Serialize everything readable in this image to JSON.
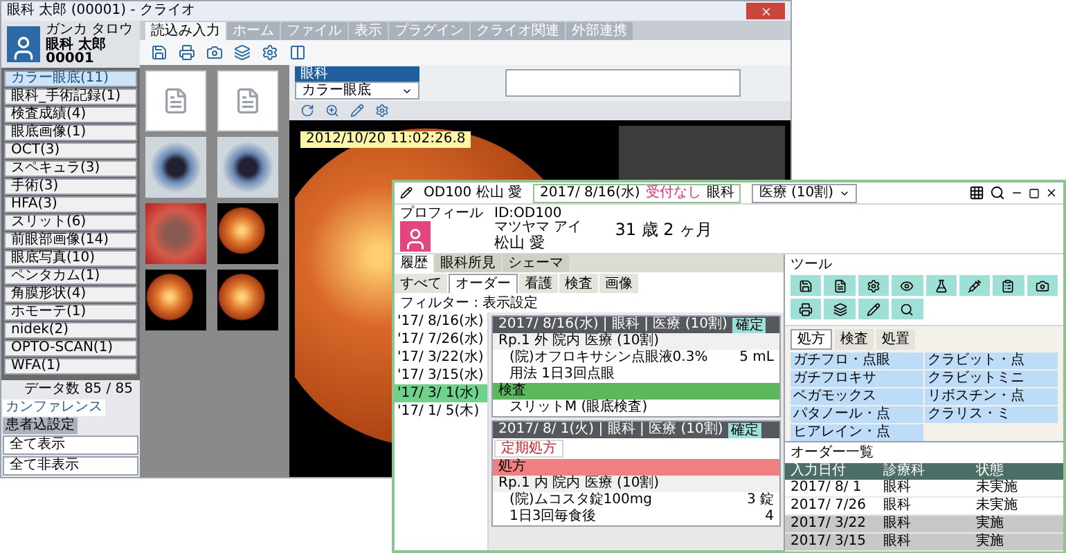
{
  "viewer_window": {
    "title": "眼科 太郎 (00001) - クライオ",
    "patient": {
      "kana": "ガンカ タロウ",
      "name": "眼科 太郎",
      "id": "00001"
    },
    "ribbon_tabs": [
      {
        "label": "読込み入力",
        "selected": true
      },
      {
        "label": "ホーム",
        "selected": false
      },
      {
        "label": "ファイル",
        "selected": false
      },
      {
        "label": "表示",
        "selected": false
      },
      {
        "label": "プラグイン",
        "selected": false
      },
      {
        "label": "クライオ関連",
        "selected": false
      },
      {
        "label": "外部連携",
        "selected": false
      }
    ],
    "categories": [
      {
        "label": "カラー眼底(11)",
        "selected": true
      },
      {
        "label": "眼科_手術記録(1)",
        "selected": false
      },
      {
        "label": "検査成績(4)",
        "selected": false
      },
      {
        "label": "眼底画像(1)",
        "selected": false
      },
      {
        "label": "OCT(3)",
        "selected": false
      },
      {
        "label": "スペキュラ(3)",
        "selected": false
      },
      {
        "label": "手術(3)",
        "selected": false
      },
      {
        "label": "HFA(3)",
        "selected": false
      },
      {
        "label": "スリット(6)",
        "selected": false
      },
      {
        "label": "前眼部画像(14)",
        "selected": false
      },
      {
        "label": "眼底写真(10)",
        "selected": false
      },
      {
        "label": "ペンタカム(1)",
        "selected": false
      },
      {
        "label": "角膜形状(4)",
        "selected": false
      },
      {
        "label": "ホモーテ(1)",
        "selected": false
      },
      {
        "label": "nidek(2)",
        "selected": false
      },
      {
        "label": "OPTO-SCAN(1)",
        "selected": false
      },
      {
        "label": "WFA(1)",
        "selected": false
      }
    ],
    "data_count": "データ数 85 / 85",
    "panel_tabs": [
      {
        "label": "カンファレンス",
        "selected": true
      },
      {
        "label": "患者込設定",
        "selected": false
      }
    ],
    "show_buttons": [
      "全て表示",
      "全て非表示"
    ],
    "thumbnails": [
      {
        "kind": "chart"
      },
      {
        "kind": "chart"
      },
      {
        "kind": "eye"
      },
      {
        "kind": "eye"
      },
      {
        "kind": "surgery"
      },
      {
        "kind": "fundus"
      },
      {
        "kind": "fundus"
      },
      {
        "kind": "fundus"
      }
    ],
    "panel_header": "眼科",
    "dropdown": {
      "value": "カラー眼底"
    },
    "timestamp": "2012/10/20 11:02:26.8"
  },
  "chart_window": {
    "header": {
      "patient": "OD100 松山 愛",
      "date": "2017/ 8/16(水)",
      "reception": "受付なし",
      "department": "眼科",
      "insurance": "医療 (10割)"
    },
    "profile": {
      "title": "プロフィール",
      "id": "ID:OD100",
      "kana": "マツヤマ アイ",
      "name": "松山 愛",
      "age": "31 歳 2 ヶ月"
    },
    "history_tabs": [
      {
        "label": "履歴",
        "selected": true
      },
      {
        "label": "眼科所見",
        "selected": false
      },
      {
        "label": "シェーマ",
        "selected": false
      }
    ],
    "filter_tabs": [
      {
        "label": "すべて",
        "selected": false
      },
      {
        "label": "オーダー",
        "selected": true
      },
      {
        "label": "看護",
        "selected": false
      },
      {
        "label": "検査",
        "selected": false
      },
      {
        "label": "画像",
        "selected": false
      }
    ],
    "filter": "フィルター : 表示設定",
    "dates": [
      {
        "label": "'17/ 8/16(水)",
        "selected": false
      },
      {
        "label": "'17/ 7/26(水)",
        "selected": false
      },
      {
        "label": "'17/ 3/22(水)",
        "selected": false
      },
      {
        "label": "'17/ 3/15(水)",
        "selected": false
      },
      {
        "label": "'17/ 3/ 1(水)",
        "selected": true
      },
      {
        "label": "'17/ 1/ 5(木)",
        "selected": false
      }
    ],
    "records": [
      {
        "header": "2017/ 8/16(水) | 眼科 | 医療 (10割)",
        "status": "確定",
        "lines": [
          {
            "kind": "rx",
            "text": "Rp.1 外 院内 医療 (10割)"
          },
          {
            "kind": "item",
            "text": "(院)オフロキサシン点眼液0.3%",
            "amount": "5 mL"
          },
          {
            "kind": "item",
            "text": "用法 1日3回点眼"
          },
          {
            "kind": "bar",
            "text": "検査",
            "color": "#5cb85c"
          },
          {
            "kind": "item",
            "text": "スリットM (眼底検査)"
          }
        ]
      },
      {
        "header": "2017/ 8/ 1(火) | 眼科 | 医療 (10割)",
        "status": "確定",
        "tag": "定期処方",
        "lines": [
          {
            "kind": "bar",
            "text": "処方",
            "color": "#f08080"
          },
          {
            "kind": "rx",
            "text": "Rp.1 内 院内 医療 (10割)"
          },
          {
            "kind": "item",
            "text": "(院)ムコスタ錠100mg",
            "amount": "3 錠"
          },
          {
            "kind": "item",
            "text": "1日3回毎食後",
            "amount": "4"
          }
        ]
      }
    ],
    "tool_title": "ツール",
    "order_categories": [
      {
        "label": "処方",
        "selected": true
      },
      {
        "label": "検査",
        "selected": false
      },
      {
        "label": "処置",
        "selected": false
      }
    ],
    "drugs": [
      "ガチフロ・点眼",
      "クラビット・点",
      "ガチフロキサ",
      "クラビットミニ",
      "ベガモックス",
      "リボスチン・点",
      "パタノール・点",
      "クラリス・ミ",
      "ヒアレイン・点"
    ],
    "order_table": {
      "title": "オーダー一覧",
      "columns": [
        "入力日付",
        "診療科",
        "状態"
      ],
      "rows": [
        {
          "cells": [
            "2017/ 8/ 1",
            "眼科",
            "未実施"
          ],
          "selected": false
        },
        {
          "cells": [
            "2017/ 7/26",
            "眼科",
            "未実施"
          ],
          "selected": false
        },
        {
          "cells": [
            "2017/ 3/22",
            "眼科",
            "実施"
          ],
          "selected": true
        },
        {
          "cells": [
            "2017/ 3/15",
            "眼科",
            "実施"
          ],
          "selected": true
        }
      ]
    }
  }
}
